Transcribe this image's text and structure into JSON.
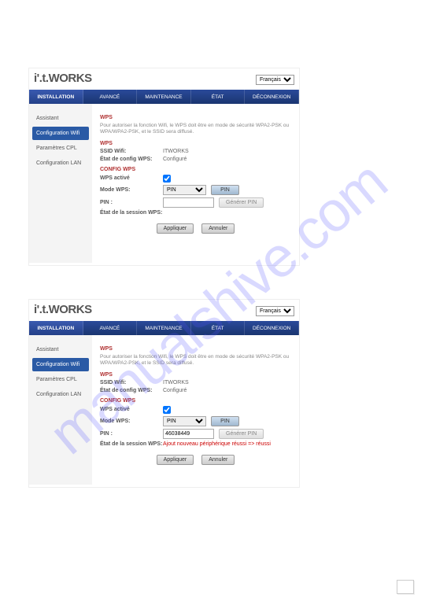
{
  "watermark": "manualshive.com",
  "logo": {
    "brand": "i'.t.",
    "suffix": "WORKS"
  },
  "language": {
    "selected": "Français"
  },
  "nav": {
    "installation": "INSTALLATION",
    "avance": "AVANCÉ",
    "maintenance": "MAINTENANCE",
    "etat": "ÉTAT",
    "deconnexion": "DÉCONNEXION"
  },
  "sidebar": {
    "assistant": "Assistant",
    "config_wifi": "Configuration Wifi",
    "param_cpl": "Paramètres CPL",
    "config_lan": "Configuration LAN"
  },
  "panel1": {
    "wps_title": "WPS",
    "wps_desc": "Pour autoriser la fonction Wifi, le WPS doit être en mode de sécurité WPA2-PSK ou WPA/WPA2-PSK, et le SSID sera diffusé.",
    "wps_section2": "WPS",
    "ssid_label": "SSID Wifi:",
    "ssid_value": "ITWORKS",
    "etat_label": "État de config WPS:",
    "etat_value": "Configuré",
    "config_wps_title": "CONFIG WPS",
    "active_label": "WPS activé",
    "mode_label": "Mode WPS:",
    "mode_value": "PIN",
    "pin_btn": "PIN",
    "pin_label": "PIN :",
    "pin_value": "",
    "gen_btn": "Générer PIN",
    "session_label": "État de la session WPS:",
    "session_value": "",
    "apply": "Appliquer",
    "cancel": "Annuler"
  },
  "panel2": {
    "wps_title": "WPS",
    "wps_desc": "Pour autoriser la fonction Wifi, le WPS doit être en mode de sécurité WPA2-PSK ou WPA/WPA2-PSK, et le SSID sera diffusé.",
    "wps_section2": "WPS",
    "ssid_label": "SSID Wifi:",
    "ssid_value": "ITWORKS",
    "etat_label": "État de config WPS:",
    "etat_value": "Configuré",
    "config_wps_title": "CONFIG WPS",
    "active_label": "WPS activé",
    "mode_label": "Mode WPS:",
    "mode_value": "PIN",
    "pin_btn": "PIN",
    "pin_label": "PIN :",
    "pin_value": "46038449",
    "gen_btn": "Générer PIN",
    "session_label": "État de la session WPS:",
    "session_value": "Ajout nouveau périphérique réussi => réussi",
    "apply": "Appliquer",
    "cancel": "Annuler"
  }
}
